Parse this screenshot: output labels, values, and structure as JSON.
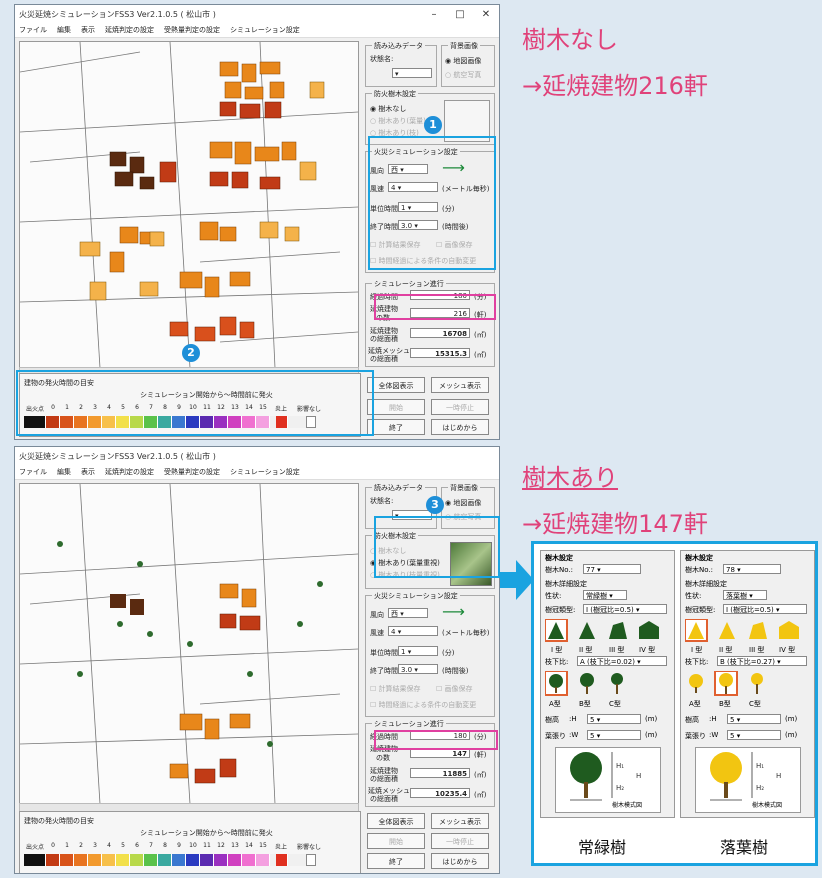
{
  "window1": {
    "title": "火災延焼シミュレーションFSS3 Ver2.1.0.5 ( 松山市 )",
    "menu": [
      "ファイル",
      "編集",
      "表示",
      "延焼判定の設定",
      "受熱量判定の設定",
      "シミュレーション設定"
    ],
    "load_data": {
      "group": "読み込みデータ",
      "scenario_label": "状態名:"
    },
    "background": {
      "group": "背景画像",
      "opt_map": "地図画像",
      "opt_photo": "航空写真"
    },
    "fire_tree": {
      "group": "防火樹木設定",
      "opt_none": "樹木なし",
      "opt_2": "樹木あり(葉量)",
      "opt_3": "樹木あり(枝)"
    },
    "sim_settings": {
      "group": "火災シミュレーション設定",
      "wind_dir_label": "風向",
      "wind_dir": "西",
      "wind_speed_label": "風速",
      "wind_speed": "4",
      "wind_unit": "(メートル毎秒)",
      "unit_time_label": "単位時間",
      "unit_time": "1",
      "unit_time_unit": "(分)",
      "end_time_label": "終了時間",
      "end_time": "3.0",
      "end_time_unit": "(時間後)",
      "chk_save": "計算結果保存",
      "chk_image": "画像保存",
      "chk_auto": "時間経過による条件の自動変更"
    },
    "progress": {
      "group": "シミュレーション進行",
      "elapsed_label": "経過時間",
      "elapsed": "180",
      "elapsed_unit": "(分)",
      "burned_label": "延焼建物",
      "burned_label2": "の数",
      "burned": "216",
      "burned_unit": "(軒)",
      "area_label": "延焼建物",
      "area_label2": "の総面積",
      "area": "16708",
      "area_unit": "(㎡)",
      "mesh_label": "延焼メッシュ",
      "mesh_label2": "の総面積",
      "mesh": "15315.3",
      "mesh_unit": "(㎡)"
    },
    "buttons": {
      "full": "全体図表示",
      "mesh": "メッシュ表示",
      "start": "開始",
      "pause": "一時停止",
      "end": "終了",
      "restart": "はじめから"
    },
    "legend": {
      "title": "建物の発火時間の目安",
      "subtitle": "シミュレーション開始から～時間前に発火",
      "start": "出火点",
      "numbers": [
        "0",
        "1",
        "2",
        "3",
        "4",
        "5",
        "6",
        "7",
        "8",
        "9",
        "10",
        "11",
        "12",
        "13",
        "14",
        "15"
      ],
      "burning": "炎上",
      "none": "影響なし"
    },
    "badge_1": "1",
    "badge_2": "2"
  },
  "window2": {
    "title": "火災延焼シミュレーションFSS3 Ver2.1.0.5 ( 松山市 )",
    "menu": [
      "ファイル",
      "編集",
      "表示",
      "延焼判定の設定",
      "受熱量判定の設定",
      "シミュレーション設定"
    ],
    "fire_tree": {
      "group": "防火樹木設定",
      "opt_none": "樹木なし",
      "opt_2": "樹木あり(葉量重視)",
      "opt_3": "樹木あり(枝量重視)"
    },
    "progress": {
      "elapsed": "180",
      "burned": "147",
      "area": "11885",
      "mesh": "10235.4"
    },
    "badge_3": "3"
  },
  "annotations": {
    "no_tree": "樹木なし",
    "no_tree_result": "→延焼建物216軒",
    "with_tree": "樹木あり",
    "with_tree_result": "→延焼建物147軒"
  },
  "tree_panels": [
    {
      "group": "樹木設定",
      "no_label": "樹木No.:",
      "no": "77",
      "detail": "樹木詳細設定",
      "type_label": "性状:",
      "type": "常緑樹",
      "crown_label": "樹冠類型:",
      "crown": "I (樹冠比=0.5)",
      "crown_types": [
        "I 型",
        "II 型",
        "III 型",
        "IV 型"
      ],
      "ratio_label": "枝下比:",
      "ratio": "A (枝下比=0.02)",
      "stem_types": [
        "A型",
        "B型",
        "C型"
      ],
      "height_label": "樹高",
      "height_key": ":H",
      "height": "5",
      "unit": "(m)",
      "width_label": "葉張り",
      "width_key": ":W",
      "width": "5",
      "diagram_label": "樹木模式図",
      "caption": "常緑樹",
      "color": "#1f5b1f"
    },
    {
      "group": "樹木設定",
      "no_label": "樹木No.:",
      "no": "78",
      "detail": "樹木詳細設定",
      "type_label": "性状:",
      "type": "落葉樹",
      "crown_label": "樹冠類型:",
      "crown": "I (樹冠比=0.5)",
      "crown_types": [
        "I 型",
        "II 型",
        "III 型",
        "IV 型"
      ],
      "ratio_label": "枝下比:",
      "ratio": "B (枝下比=0.27)",
      "stem_types": [
        "A型",
        "B型",
        "C型"
      ],
      "height_label": "樹高",
      "height_key": ":H",
      "height": "5",
      "unit": "(m)",
      "width_label": "葉張り",
      "width_key": ":W",
      "width": "5",
      "diagram_label": "樹木模式図",
      "caption": "落葉樹",
      "color": "#f2c511"
    }
  ],
  "colors": {
    "highlight": "#1aa3e0",
    "magenta": "#e040a0",
    "annotation": "#e0427a"
  }
}
